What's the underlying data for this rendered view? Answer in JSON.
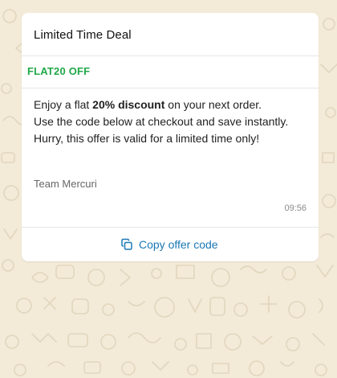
{
  "card": {
    "title": "Limited Time Deal",
    "tagline": "FLAT20 OFF",
    "message": {
      "line1_prefix": "Enjoy a flat ",
      "line1_bold": "20% discount",
      "line1_suffix": " on your next order.",
      "line2": "Use the code below at checkout and save instantly.",
      "line3": "Hurry, this offer is valid for a limited time only!"
    },
    "signature": "Team Mercuri",
    "time": "09:56",
    "action": {
      "label": "Copy offer code",
      "icon": "copy-icon"
    }
  },
  "colors": {
    "background": "#f3ead8",
    "tagline": "#20a848",
    "action": "#1a78b5"
  }
}
